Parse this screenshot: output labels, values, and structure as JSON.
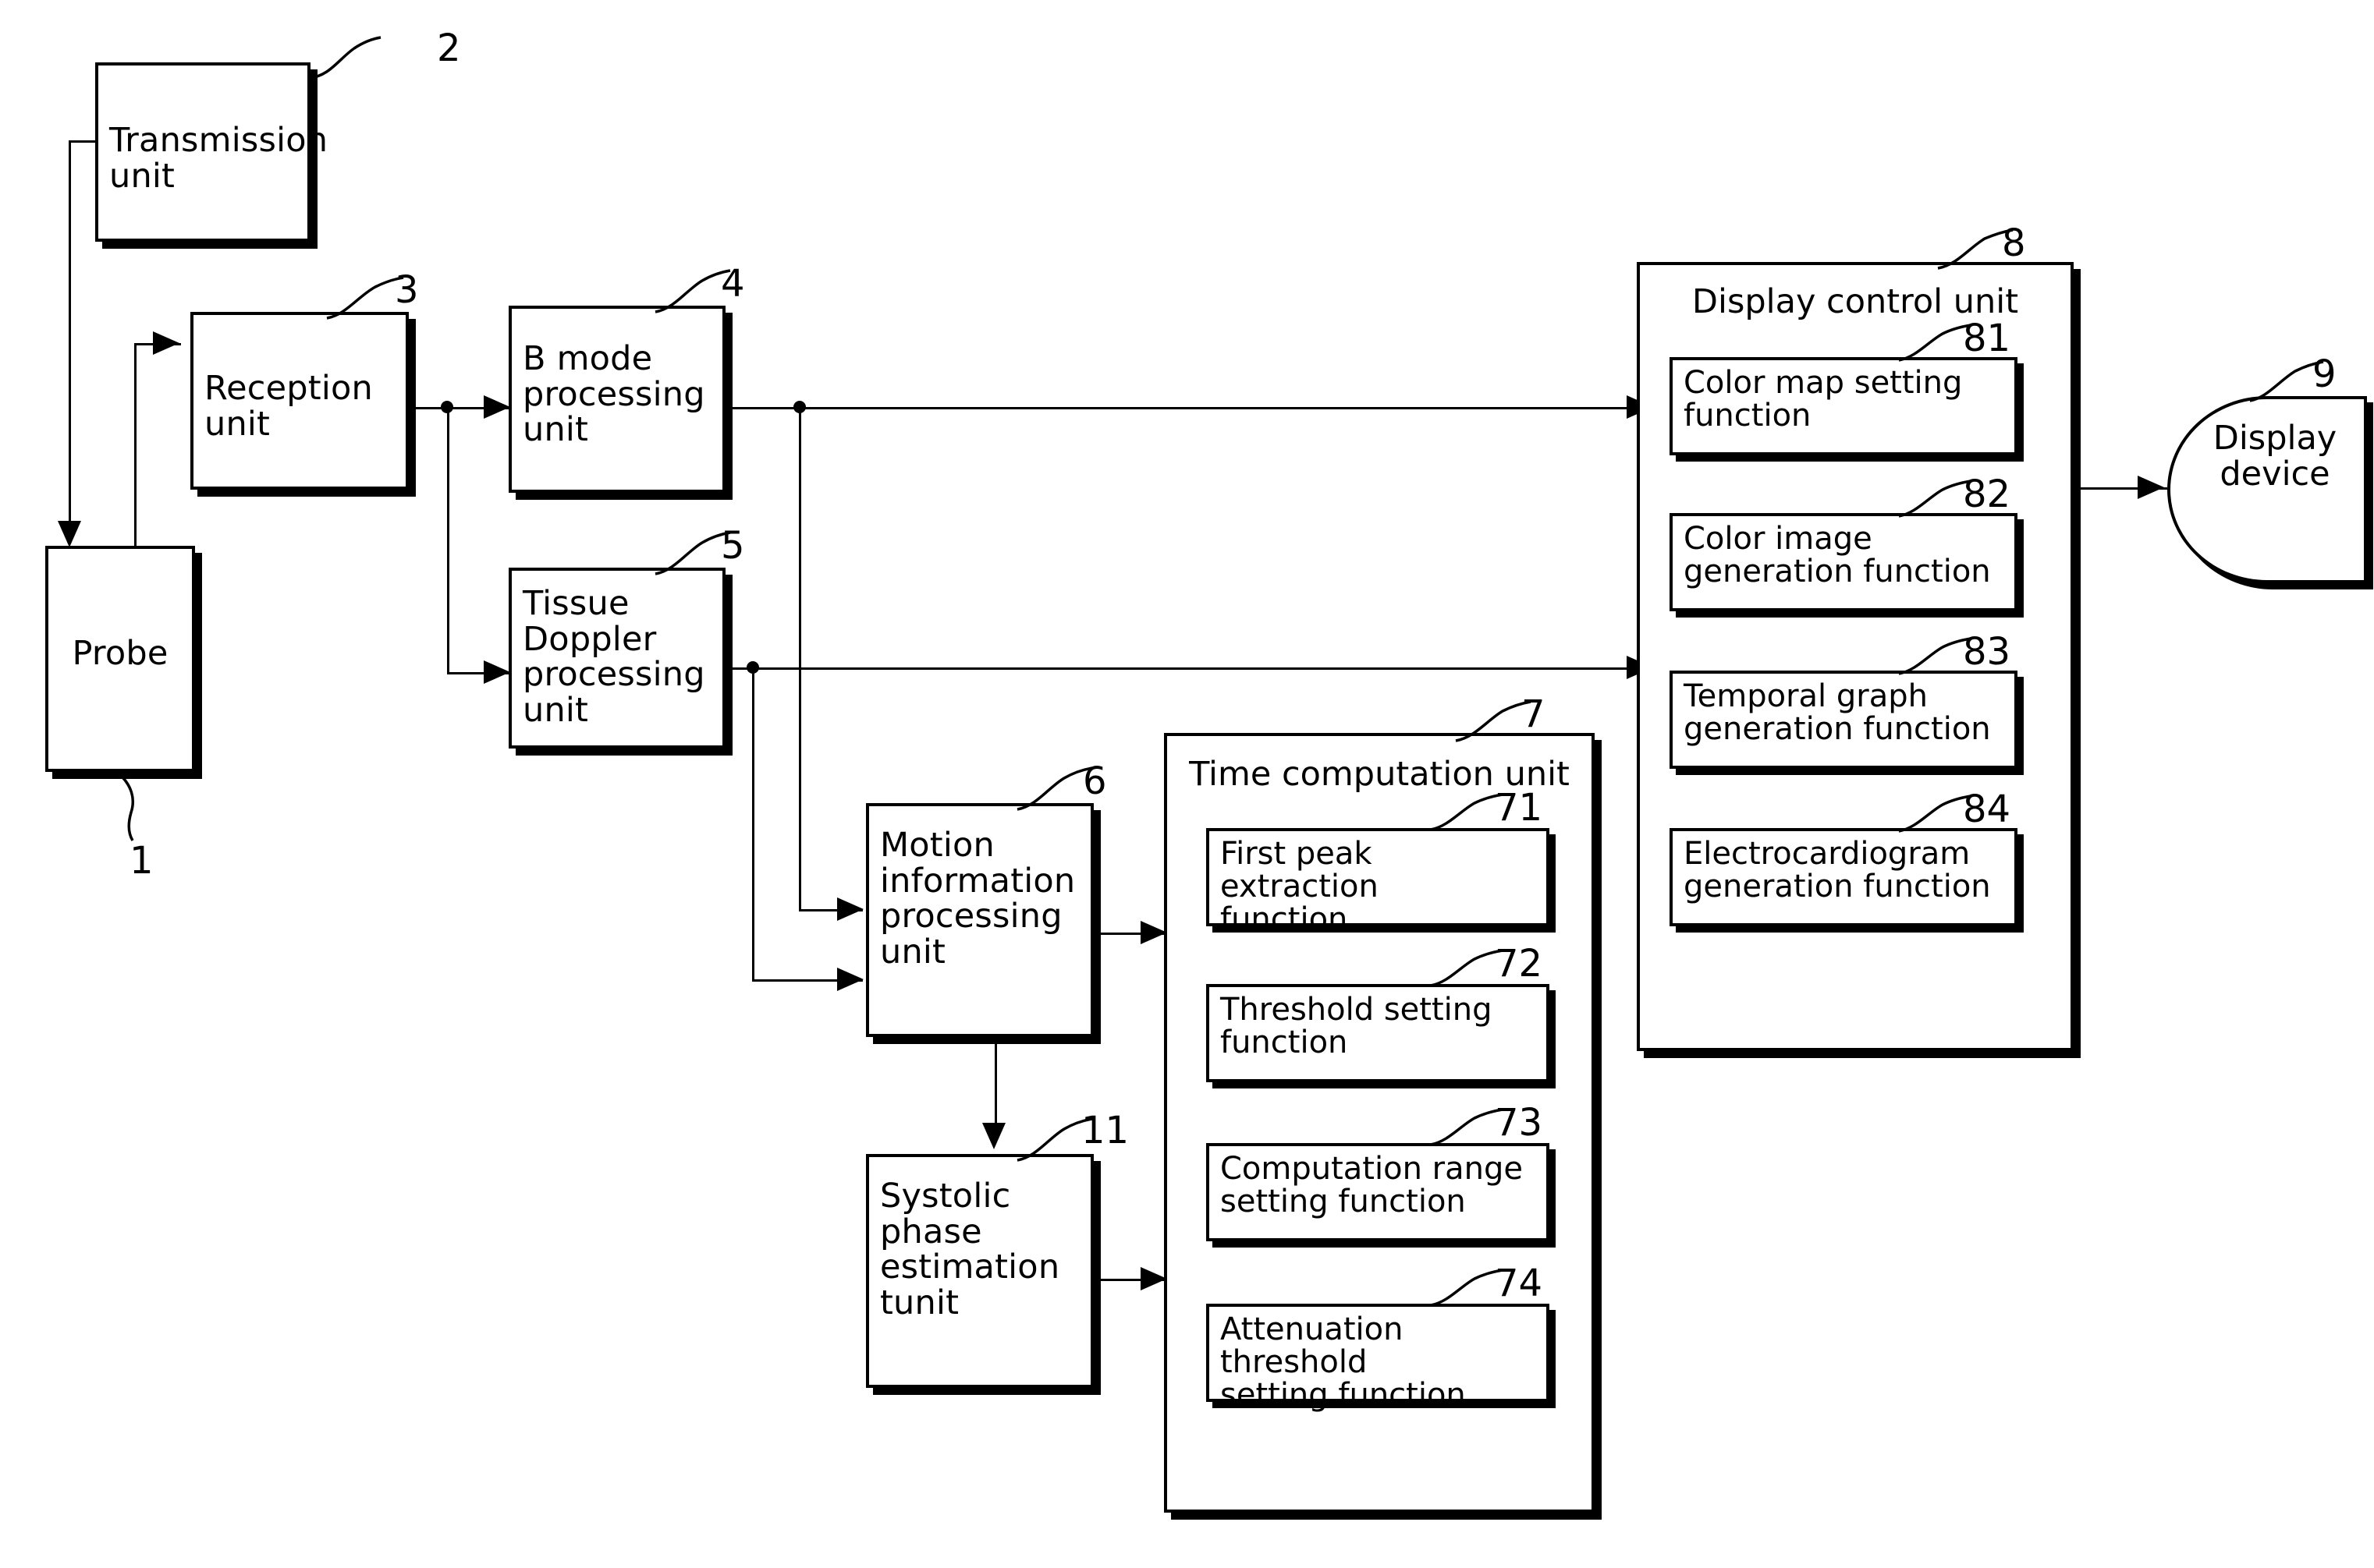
{
  "figure": {
    "type": "block-diagram",
    "blocks": [
      {
        "id": "transmission-unit",
        "ref": "2",
        "label": "Transmission\nunit"
      },
      {
        "id": "reception-unit",
        "ref": "3",
        "label": "Reception\nunit"
      },
      {
        "id": "probe",
        "ref": "1",
        "label": "Probe"
      },
      {
        "id": "b-mode-processing-unit",
        "ref": "4",
        "label": "B mode\nprocessing\nunit"
      },
      {
        "id": "tissue-doppler-processing-unit",
        "ref": "5",
        "label": "Tissue\nDoppler\nprocessing\nunit"
      },
      {
        "id": "motion-information-processing-unit",
        "ref": "6",
        "label": "Motion\ninformation\nprocessing\nunit"
      },
      {
        "id": "systolic-phase-estimation-unit",
        "ref": "11",
        "label": "Systolic\nphase\nestimation\ntunit"
      },
      {
        "id": "display-device",
        "ref": "9",
        "label": "Display\ndevice"
      }
    ],
    "time_computation_unit": {
      "ref": "7",
      "title": "Time computation unit",
      "functions": [
        {
          "ref": "71",
          "label": "First peak extraction\nfunction"
        },
        {
          "ref": "72",
          "label": "Threshold setting\nfunction"
        },
        {
          "ref": "73",
          "label": "Computation range\nsetting function"
        },
        {
          "ref": "74",
          "label": "Attenuation threshold\nsetting function"
        }
      ]
    },
    "display_control_unit": {
      "ref": "8",
      "title": "Display control unit",
      "functions": [
        {
          "ref": "81",
          "label": "Color map setting\nfunction"
        },
        {
          "ref": "82",
          "label": "Color image\ngeneration function"
        },
        {
          "ref": "83",
          "label": "Temporal graph\ngeneration function"
        },
        {
          "ref": "84",
          "label": "Electrocardiogram\ngeneration function"
        }
      ]
    },
    "colors": {
      "ink": "#000000",
      "paper": "#ffffff"
    }
  }
}
